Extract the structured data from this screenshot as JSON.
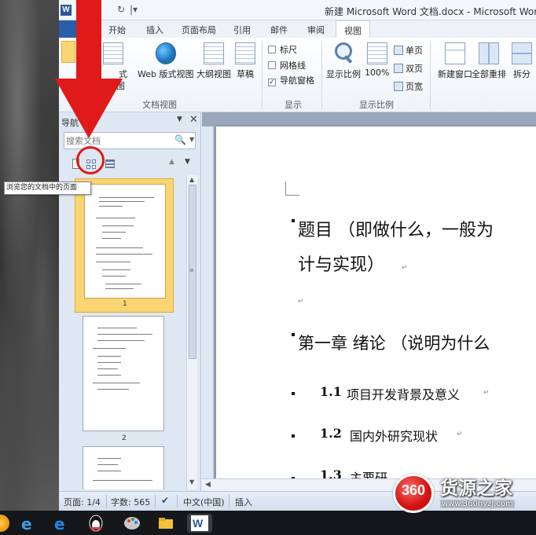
{
  "window": {
    "title": "新建 Microsoft Word 文档.docx - Microsoft Word",
    "logo": "W",
    "quick_access": [
      "↶",
      "↻",
      "|▾"
    ]
  },
  "ribbon_tabs": [
    {
      "label": "开始"
    },
    {
      "label": "插入"
    },
    {
      "label": "页面布局"
    },
    {
      "label": "引用"
    },
    {
      "label": "邮件"
    },
    {
      "label": "审阅"
    },
    {
      "label": "视图",
      "active": true
    }
  ],
  "ribbon": {
    "doc_views": {
      "partial_label_line1": "式",
      "partial_label_line2": "见图",
      "web_layout": "Web 版式视图",
      "outline": "大纲视图",
      "draft": "草稿",
      "group": "文档视图"
    },
    "show": {
      "ruler": "标尺",
      "gridlines": "网格线",
      "nav_pane": "导航窗格",
      "nav_pane_checked": true,
      "group": "显示"
    },
    "zoom": {
      "zoom": "显示比例",
      "hundred": "100%",
      "one_page": "单页",
      "two_pages": "双页",
      "page_width": "页宽",
      "group": "显示比例"
    },
    "window": {
      "new_window": "新建窗口",
      "arrange_all": "全部重排",
      "split": "拆分"
    }
  },
  "nav_pane": {
    "title": "导航",
    "menu_icon": "▼",
    "close_icon": "✕",
    "search_placeholder": "搜索文档",
    "search_icon": "🔍",
    "tooltip": "浏览您的文档中的页面",
    "prev": "▲",
    "next": "▼",
    "pages": [
      "1",
      "2"
    ]
  },
  "document": {
    "title_line1": "题目 （即做什么，一般为",
    "title_line2": "计与实现）",
    "chapter": "第一章  绪论  （说明为什么",
    "sections": [
      {
        "num": "1.1",
        "text": "项目开发背景及意义"
      },
      {
        "num": "1.2",
        "text": "国内外研究现状"
      },
      {
        "num": "1.3",
        "text": "主要研"
      }
    ],
    "para_mark": "↵",
    "bullet": "▪"
  },
  "status_bar": {
    "page": "页面: 1/4",
    "words": "字数: 565",
    "language": "中文(中国)",
    "mode": "插入"
  },
  "annotation": {
    "arrow_color": "#e01919"
  },
  "watermark": {
    "badge": "360",
    "name": "货源之家",
    "url": "www.360hyzj.com"
  }
}
